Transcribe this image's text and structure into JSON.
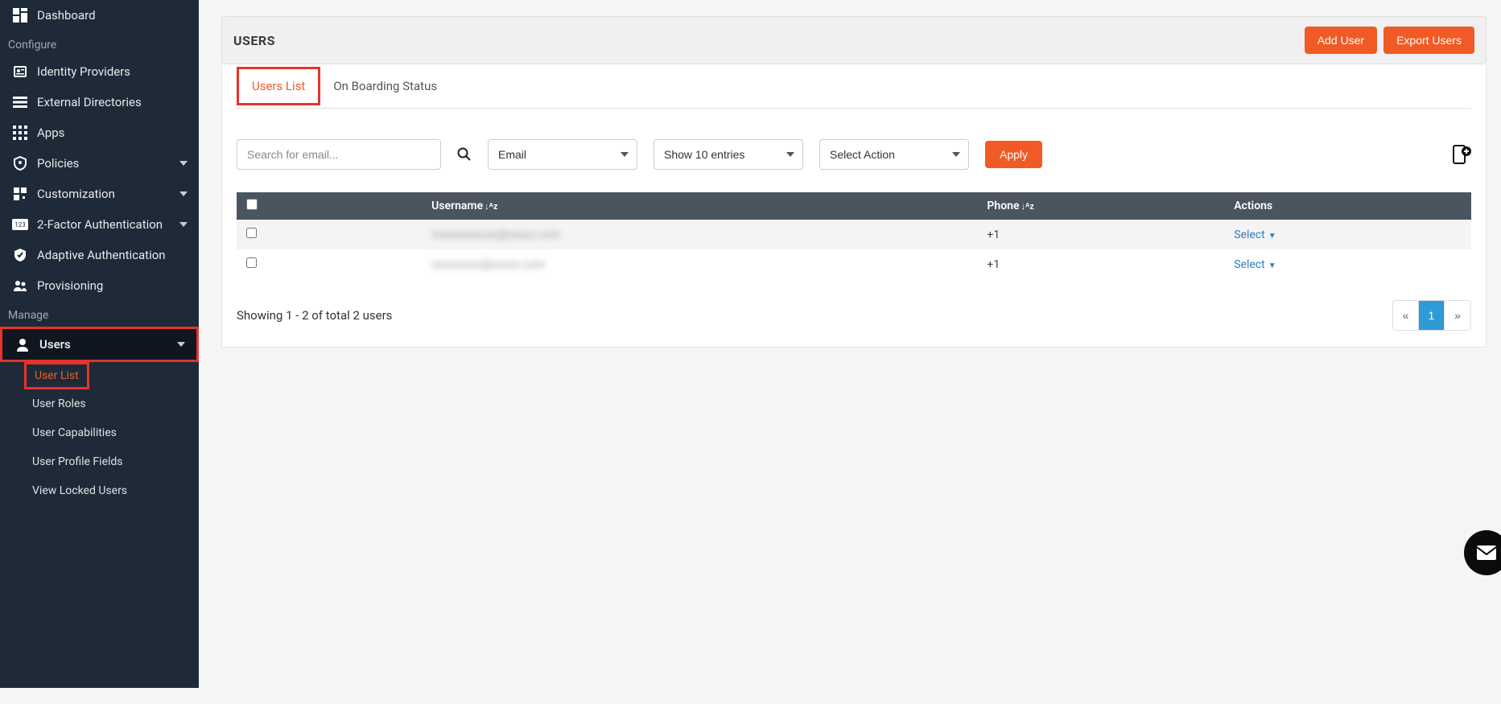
{
  "sidebar": {
    "items": [
      {
        "label": "Dashboard"
      }
    ],
    "section_configure": "Configure",
    "configure": [
      {
        "label": "Identity Providers"
      },
      {
        "label": "External Directories"
      },
      {
        "label": "Apps"
      },
      {
        "label": "Policies",
        "chevron": true
      },
      {
        "label": "Customization",
        "chevron": true
      },
      {
        "label": "2-Factor Authentication",
        "chevron": true
      },
      {
        "label": "Adaptive Authentication"
      },
      {
        "label": "Provisioning"
      }
    ],
    "section_manage": "Manage",
    "manage": [
      {
        "label": "Users",
        "chevron": true,
        "active": true,
        "children": [
          {
            "label": "User List",
            "active": true
          },
          {
            "label": "User Roles"
          },
          {
            "label": "User Capabilities"
          },
          {
            "label": "User Profile Fields"
          },
          {
            "label": "View Locked Users"
          }
        ]
      }
    ]
  },
  "header": {
    "title": "USERS",
    "add_user": "Add User",
    "export_users": "Export Users"
  },
  "tabs": [
    {
      "label": "Users List",
      "active": true
    },
    {
      "label": "On Boarding Status"
    }
  ],
  "filters": {
    "search_placeholder": "Search for email...",
    "search_value": "",
    "type_select": "Email",
    "entries_select": "Show 10 entries",
    "action_select": "Select Action",
    "apply_label": "Apply"
  },
  "table": {
    "headers": {
      "username": "Username",
      "phone": "Phone",
      "actions": "Actions"
    },
    "rows": [
      {
        "username": "mxxxxxxxxxx@xxxxx.com",
        "phone": "+1",
        "action": "Select"
      },
      {
        "username": "sxxxxxxxx@xxxxx.com",
        "phone": "+1",
        "action": "Select"
      }
    ],
    "showing": "Showing 1 - 2 of total 2 users",
    "pagination": {
      "prev": "«",
      "pages": [
        "1"
      ],
      "next": "»",
      "current": "1"
    }
  }
}
